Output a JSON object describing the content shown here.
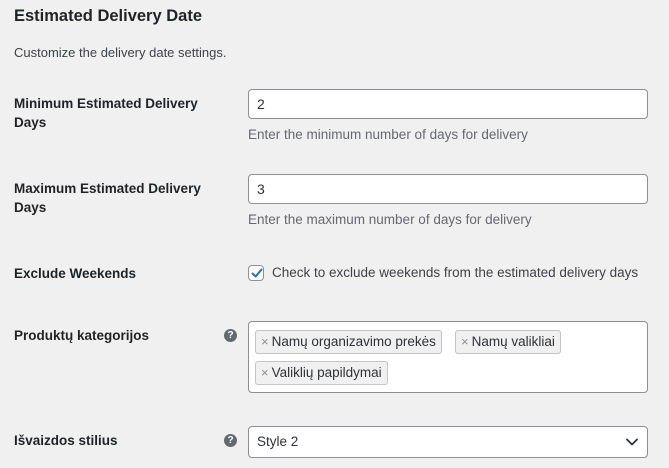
{
  "header": {
    "title": "Estimated Delivery Date",
    "description": "Customize the delivery date settings."
  },
  "fields": {
    "min_days": {
      "label": "Minimum Estimated Delivery Days",
      "value": "2",
      "help": "Enter the minimum number of days for delivery"
    },
    "max_days": {
      "label": "Maximum Estimated Delivery Days",
      "value": "3",
      "help": "Enter the maximum number of days for delivery"
    },
    "exclude_weekends": {
      "label": "Exclude Weekends",
      "checked": true,
      "checkbox_label": "Check to exclude weekends from the estimated delivery days"
    },
    "categories": {
      "label": "Produktų kategorijos",
      "tip_icon": "question-circle-icon",
      "remove_glyph": "×",
      "chips": [
        "Namų organizavimo prekės",
        "Namų valikliai",
        "Valiklių papildymai"
      ]
    },
    "style": {
      "label": "Išvaizdos stilius",
      "tip_icon": "question-circle-icon",
      "selected": "Style 2"
    }
  },
  "colors": {
    "accent": "#2271b1",
    "background": "#f0f0f1",
    "border": "#8c8f94",
    "help_text": "#646970"
  }
}
